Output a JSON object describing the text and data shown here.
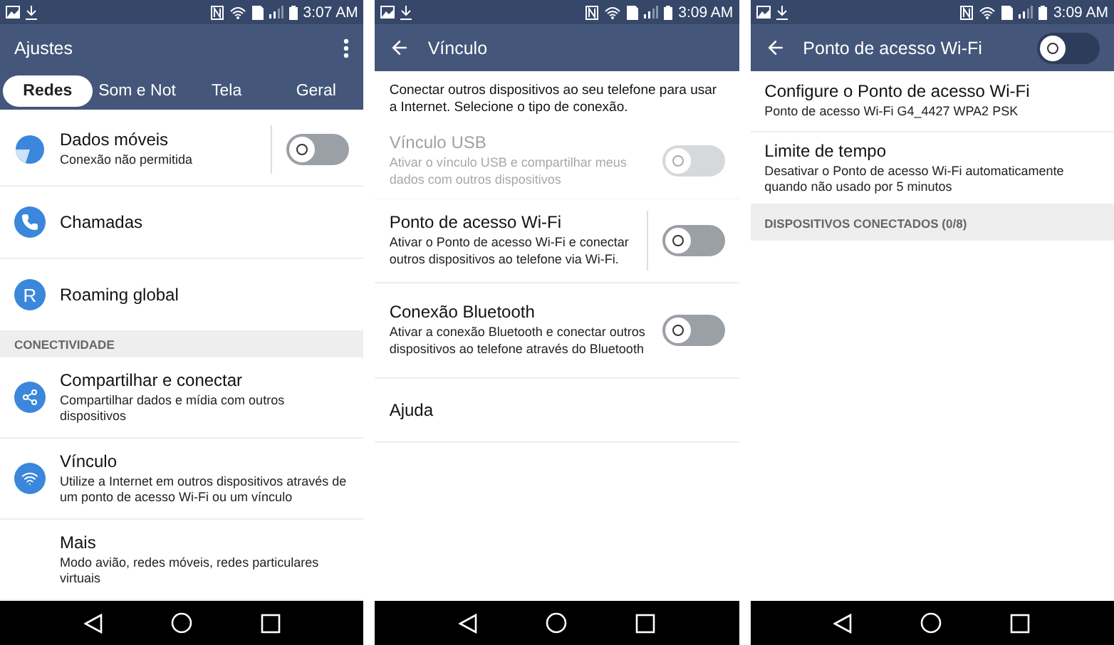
{
  "screens": [
    {
      "status_time": "3:07 AM",
      "app_bar": {
        "title": "Ajustes",
        "back": false,
        "menu": true
      },
      "tabs": [
        {
          "label": "Redes",
          "selected": true
        },
        {
          "label": "Som e Not",
          "selected": false
        },
        {
          "label": "Tela",
          "selected": false
        },
        {
          "label": "Geral",
          "selected": false
        }
      ],
      "rows": [
        {
          "kind": "setting",
          "title": "Dados móveis",
          "subtitle": "Conexão não permitida",
          "toggle": {
            "on": false
          },
          "split": true
        },
        {
          "kind": "setting",
          "title": "Chamadas"
        },
        {
          "kind": "setting",
          "icon_letter": "R",
          "title": "Roaming global"
        },
        {
          "kind": "section",
          "title": "CONECTIVIDADE"
        },
        {
          "kind": "setting",
          "title": "Compartilhar e conectar",
          "subtitle": "Compartilhar dados e mídia com outros dispositivos"
        },
        {
          "kind": "setting",
          "title": "Vínculo",
          "subtitle": "Utilize a Internet em outros dispositivos através de um ponto de acesso Wi-Fi ou um vínculo"
        },
        {
          "kind": "setting",
          "title": "Mais",
          "subtitle": "Modo avião, redes móveis, redes particulares virtuais"
        }
      ]
    },
    {
      "status_time": "3:09 AM",
      "app_bar": {
        "title": "Vínculo",
        "back": true,
        "menu": false
      },
      "intro": "Conectar outros dispositivos ao seu telefone para usar a Internet. Selecione o tipo de conexão.",
      "rows": [
        {
          "kind": "setting",
          "title": "Vínculo USB",
          "subtitle": "Ativar o vínculo USB e compartilhar meus dados com outros dispositivos",
          "toggle": {
            "on": false
          },
          "disabled": true
        },
        {
          "kind": "setting",
          "title": "Ponto de acesso Wi-Fi",
          "subtitle": "Ativar o Ponto de acesso Wi-Fi e conectar outros dispositivos ao telefone via Wi-Fi.",
          "toggle": {
            "on": false
          },
          "split": true
        },
        {
          "kind": "setting",
          "title": "Conexão Bluetooth",
          "subtitle": "Ativar a conexão Bluetooth e conectar outros dispositivos ao telefone através do Bluetooth",
          "toggle": {
            "on": false
          }
        },
        {
          "kind": "setting",
          "title": "Ajuda"
        }
      ]
    },
    {
      "status_time": "3:09 AM",
      "app_bar": {
        "title": "Ponto de acesso Wi-Fi",
        "back": true,
        "menu": false,
        "toggle": {
          "on": false
        }
      },
      "rows": [
        {
          "kind": "setting",
          "title": "Configure o Ponto de acesso Wi-Fi",
          "subtitle": "Ponto de acesso Wi-Fi G4_4427 WPA2 PSK"
        },
        {
          "kind": "setting",
          "title": "Limite de tempo",
          "subtitle": "Desativar o Ponto de acesso Wi-Fi automaticamente quando não usado por 5 minutos"
        },
        {
          "kind": "section",
          "title": "DISPOSITIVOS CONECTADOS (0/8)"
        }
      ]
    }
  ]
}
